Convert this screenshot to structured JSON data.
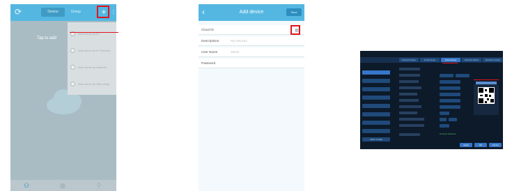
{
  "panel1": {
    "tabs": [
      "Device",
      "Group"
    ],
    "hint_text": "Tap to add",
    "menu_items": [
      "Add device by ID",
      "Add device by IP /Domain",
      "Add device by Network",
      "Add device by Wifi config"
    ]
  },
  "panel2": {
    "title": "Add device",
    "save_label": "Save",
    "fields": [
      {
        "label": "Cloud ID",
        "value": ""
      },
      {
        "label": "Descriptions",
        "value": "My Device1"
      },
      {
        "label": "User Name",
        "value": "admin"
      },
      {
        "label": "Password",
        "value": ""
      }
    ],
    "qr_icon_glyph": "▦"
  },
  "panel3": {
    "tabs": [
      "Network Setup",
      "Email Setup",
      "Cloud Setup",
      "Network Status",
      "Network Config"
    ],
    "active_tab_index": 2,
    "side_items": [
      "",
      "",
      "",
      "",
      "",
      "",
      "",
      "",
      "Alarm Config"
    ],
    "status_text": "Connect Success",
    "bottom_buttons": [
      "Apply",
      "OK",
      "Cancel"
    ]
  },
  "colors": {
    "accent": "#54b7e2",
    "highlight": "#e0141b",
    "nvr_bg": "#0d1a2a",
    "nvr_active": "#3677c7",
    "success": "#46d24f"
  }
}
